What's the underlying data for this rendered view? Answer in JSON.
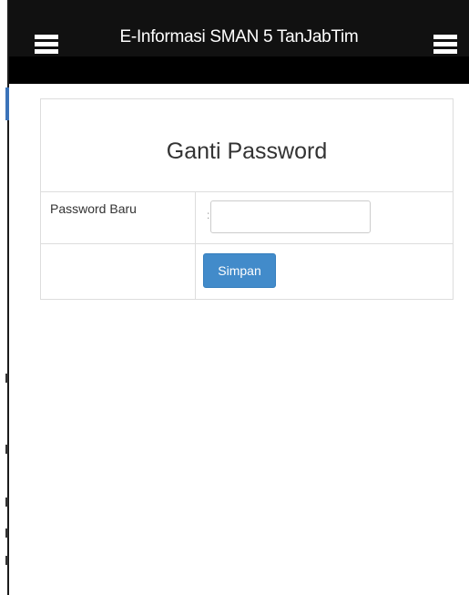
{
  "header": {
    "title": "E-Informasi SMAN 5 TanJabTim",
    "left_menu_icon": "hamburger-menu-icon",
    "right_menu_icon": "hamburger-menu-icon",
    "background_color": "#000000"
  },
  "form": {
    "heading": "Ganti Password",
    "new_password_label": "Password Baru",
    "separator": ":",
    "new_password_value": "",
    "new_password_placeholder": "",
    "save_label": "Simpan",
    "save_button_color": "#428bca"
  }
}
